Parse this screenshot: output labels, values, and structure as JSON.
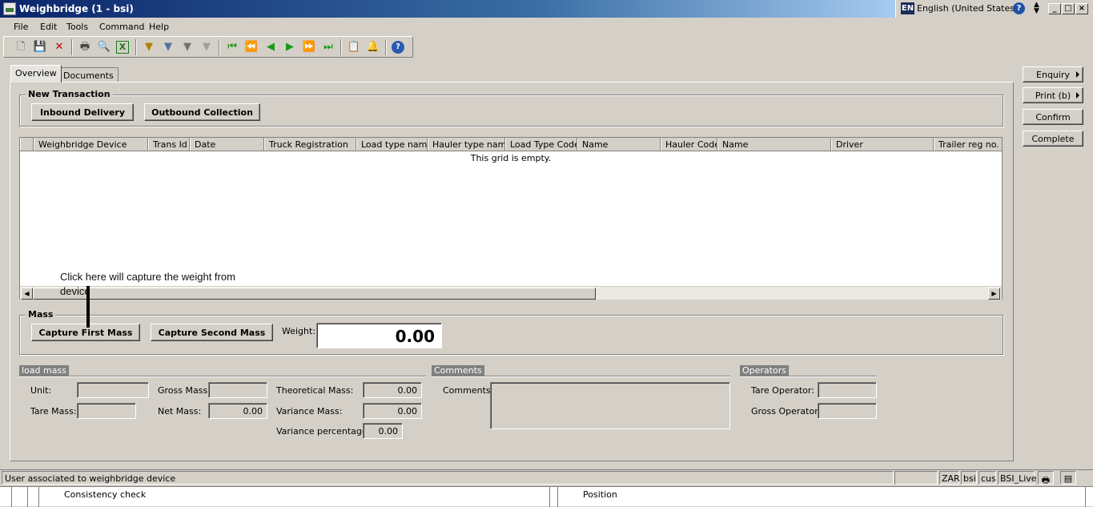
{
  "window": {
    "title": "Weighbridge (1 - bsi)",
    "language": "English (United States)",
    "lang_code": "EN"
  },
  "menu": [
    "File",
    "Edit",
    "Tools",
    "Command",
    "Help"
  ],
  "tabs": [
    "Overview",
    "Documents"
  ],
  "new_transaction": {
    "label": "New Transaction",
    "inbound": "Inbound Delivery",
    "outbound": "Outbound Collection"
  },
  "grid": {
    "columns": [
      "Weighbridge Device",
      "Trans Id",
      "Date",
      "Truck Registration",
      "Load type name",
      "Hauler type name",
      "Load Type Code",
      "Name",
      "Hauler Code",
      "Name",
      "Driver",
      "Trailer reg no."
    ],
    "empty_text": "This grid is empty."
  },
  "annotation": "Click here will capture the weight from device",
  "mass": {
    "label": "Mass",
    "capture_first": "Capture First Mass",
    "capture_second": "Capture Second Mass",
    "weight_label": "Weight:",
    "weight_value": "0.00"
  },
  "load_mass": {
    "label": "load mass",
    "unit_label": "Unit:",
    "unit_value": "",
    "tare_label": "Tare Mass:",
    "tare_value": "",
    "gross_label": "Gross Mass:",
    "gross_value": "",
    "net_label": "Net Mass:",
    "net_value": "0.00",
    "theoretical_label": "Theoretical Mass:",
    "theoretical_value": "0.00",
    "variance_label": "Variance Mass:",
    "variance_value": "0.00",
    "variance_pct_label": "Variance percentage:",
    "variance_pct_value": "0.00"
  },
  "comments": {
    "label": "Comments",
    "field_label": "Comments:",
    "value": ""
  },
  "operators": {
    "label": "Operators",
    "tare_label": "Tare Operator:",
    "tare_value": "",
    "gross_label": "Gross Operator:",
    "gross_value": ""
  },
  "side_buttons": {
    "enquiry": "Enquiry",
    "print": "Print (b)",
    "confirm": "Confirm",
    "complete": "Complete"
  },
  "status": {
    "message": "User associated to weighbridge device",
    "currency": "ZAR",
    "company": "bsi",
    "user": "cus",
    "environment": "BSI_Live"
  },
  "bottom": {
    "left": "Consistency check",
    "right": "Position"
  }
}
